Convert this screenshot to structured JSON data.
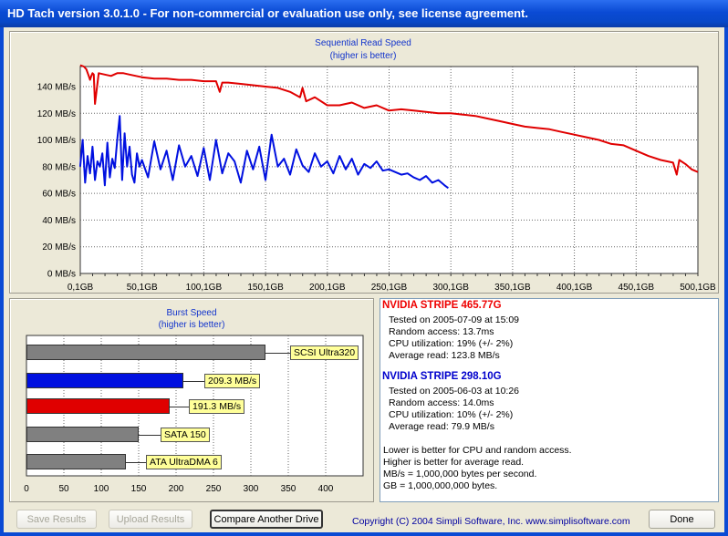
{
  "window": {
    "title": "HD Tach version 3.0.1.0  - For non-commercial or evaluation use only, see license agreement."
  },
  "colors": {
    "drive1": "#e00000",
    "drive2": "#0010e0",
    "reference": "#808080",
    "titlebar": "#0a4ad4"
  },
  "chart_data": [
    {
      "type": "line",
      "title": "Sequential Read Speed",
      "subtitle": "(higher is better)",
      "xlabel": "",
      "ylabel": "",
      "x_ticks": [
        "0,1GB",
        "50,1GB",
        "100,1GB",
        "150,1GB",
        "200,1GB",
        "250,1GB",
        "300,1GB",
        "350,1GB",
        "400,1GB",
        "450,1GB",
        "500,1GB"
      ],
      "y_ticks": [
        "0 MB/s",
        "20 MB/s",
        "40 MB/s",
        "60 MB/s",
        "80 MB/s",
        "100 MB/s",
        "120 MB/s",
        "140 MB/s"
      ],
      "xlim": [
        0.1,
        500.1
      ],
      "ylim": [
        0,
        155
      ],
      "grid": true,
      "series": [
        {
          "name": "NVIDIA STRIPE 465.77G",
          "color": "#e00000",
          "x": [
            0,
            3,
            5,
            7,
            8,
            9,
            10,
            11,
            12,
            15,
            20,
            25,
            30,
            35,
            40,
            50,
            60,
            70,
            80,
            90,
            100,
            110,
            113,
            115,
            118,
            120,
            130,
            140,
            150,
            160,
            170,
            178,
            180,
            183,
            190,
            200,
            210,
            220,
            230,
            240,
            250,
            260,
            270,
            280,
            290,
            300,
            310,
            320,
            330,
            340,
            350,
            360,
            370,
            380,
            390,
            400,
            410,
            420,
            430,
            440,
            450,
            460,
            470,
            480,
            483,
            485,
            490,
            495,
            500
          ],
          "y": [
            156,
            155,
            153,
            148,
            145,
            148,
            150,
            149,
            127,
            150,
            149,
            148,
            150,
            150,
            149,
            147,
            146,
            146,
            145,
            145,
            144,
            144,
            136,
            143,
            143,
            143,
            142,
            141,
            140,
            139,
            136,
            132,
            139,
            129,
            132,
            126,
            126,
            128,
            124,
            126,
            122,
            123,
            122,
            121,
            120,
            120,
            119,
            118,
            116,
            114,
            112,
            110,
            109,
            108,
            106,
            104,
            102,
            100,
            97,
            96,
            92,
            88,
            85,
            83,
            74,
            85,
            82,
            78,
            76
          ]
        },
        {
          "name": "NVIDIA STRIPE 298.10G",
          "color": "#0010e0",
          "x": [
            0,
            2,
            4,
            6,
            8,
            10,
            12,
            14,
            16,
            18,
            20,
            22,
            24,
            26,
            28,
            30,
            32,
            34,
            36,
            38,
            40,
            42,
            44,
            46,
            48,
            50,
            55,
            60,
            65,
            70,
            75,
            80,
            85,
            90,
            95,
            100,
            105,
            110,
            115,
            120,
            125,
            130,
            135,
            140,
            145,
            150,
            155,
            160,
            165,
            170,
            175,
            180,
            185,
            190,
            195,
            200,
            205,
            210,
            215,
            220,
            225,
            230,
            235,
            240,
            245,
            250,
            255,
            260,
            265,
            270,
            275,
            280,
            285,
            290,
            295,
            298
          ],
          "y": [
            80,
            100,
            68,
            88,
            75,
            95,
            70,
            84,
            80,
            90,
            66,
            98,
            72,
            86,
            79,
            100,
            118,
            70,
            105,
            80,
            95,
            74,
            68,
            90,
            80,
            85,
            72,
            99,
            78,
            92,
            70,
            96,
            80,
            88,
            73,
            94,
            70,
            100,
            75,
            90,
            84,
            68,
            92,
            78,
            95,
            70,
            104,
            80,
            86,
            74,
            93,
            81,
            76,
            90,
            80,
            84,
            75,
            88,
            78,
            86,
            74,
            82,
            79,
            84,
            77,
            78,
            76,
            74,
            75,
            72,
            70,
            73,
            68,
            70,
            66,
            64
          ]
        }
      ]
    },
    {
      "type": "bar",
      "orientation": "horizontal",
      "title": "Burst Speed",
      "subtitle": "(higher is better)",
      "xlim": [
        0,
        450
      ],
      "x_ticks": [
        "0",
        "50",
        "100",
        "150",
        "200",
        "250",
        "300",
        "350",
        "400"
      ],
      "grid": true,
      "categories": [
        "SCSI Ultra320",
        "209.3 MB/s",
        "191.3 MB/s",
        "SATA 150",
        "ATA UltraDMA 6"
      ],
      "values": [
        320,
        209.3,
        191.3,
        150,
        133
      ],
      "colors": [
        "#808080",
        "#0010e0",
        "#e00000",
        "#808080",
        "#808080"
      ]
    }
  ],
  "drive1": {
    "name": "NVIDIA STRIPE 465.77G",
    "tested": "Tested on 2005-07-09 at 15:09",
    "random_access": "Random access: 13.7ms",
    "cpu": "CPU utilization: 19% (+/- 2%)",
    "avg_read": "Average read: 123.8 MB/s"
  },
  "drive2": {
    "name": "NVIDIA STRIPE 298.10G",
    "tested": "Tested on 2005-06-03 at 10:26",
    "random_access": "Random access: 14.0ms",
    "cpu": "CPU utilization: 10% (+/- 2%)",
    "avg_read": "Average read: 79.9 MB/s"
  },
  "notes": [
    "Lower is better for CPU and random access.",
    "Higher is better for average read.",
    "MB/s = 1,000,000 bytes per second.",
    "GB = 1,000,000,000 bytes."
  ],
  "buttons": {
    "save": "Save Results",
    "upload": "Upload Results",
    "compare": "Compare Another Drive",
    "done": "Done"
  },
  "copyright": "Copyright (C) 2004 Simpli Software, Inc. www.simplisoftware.com"
}
